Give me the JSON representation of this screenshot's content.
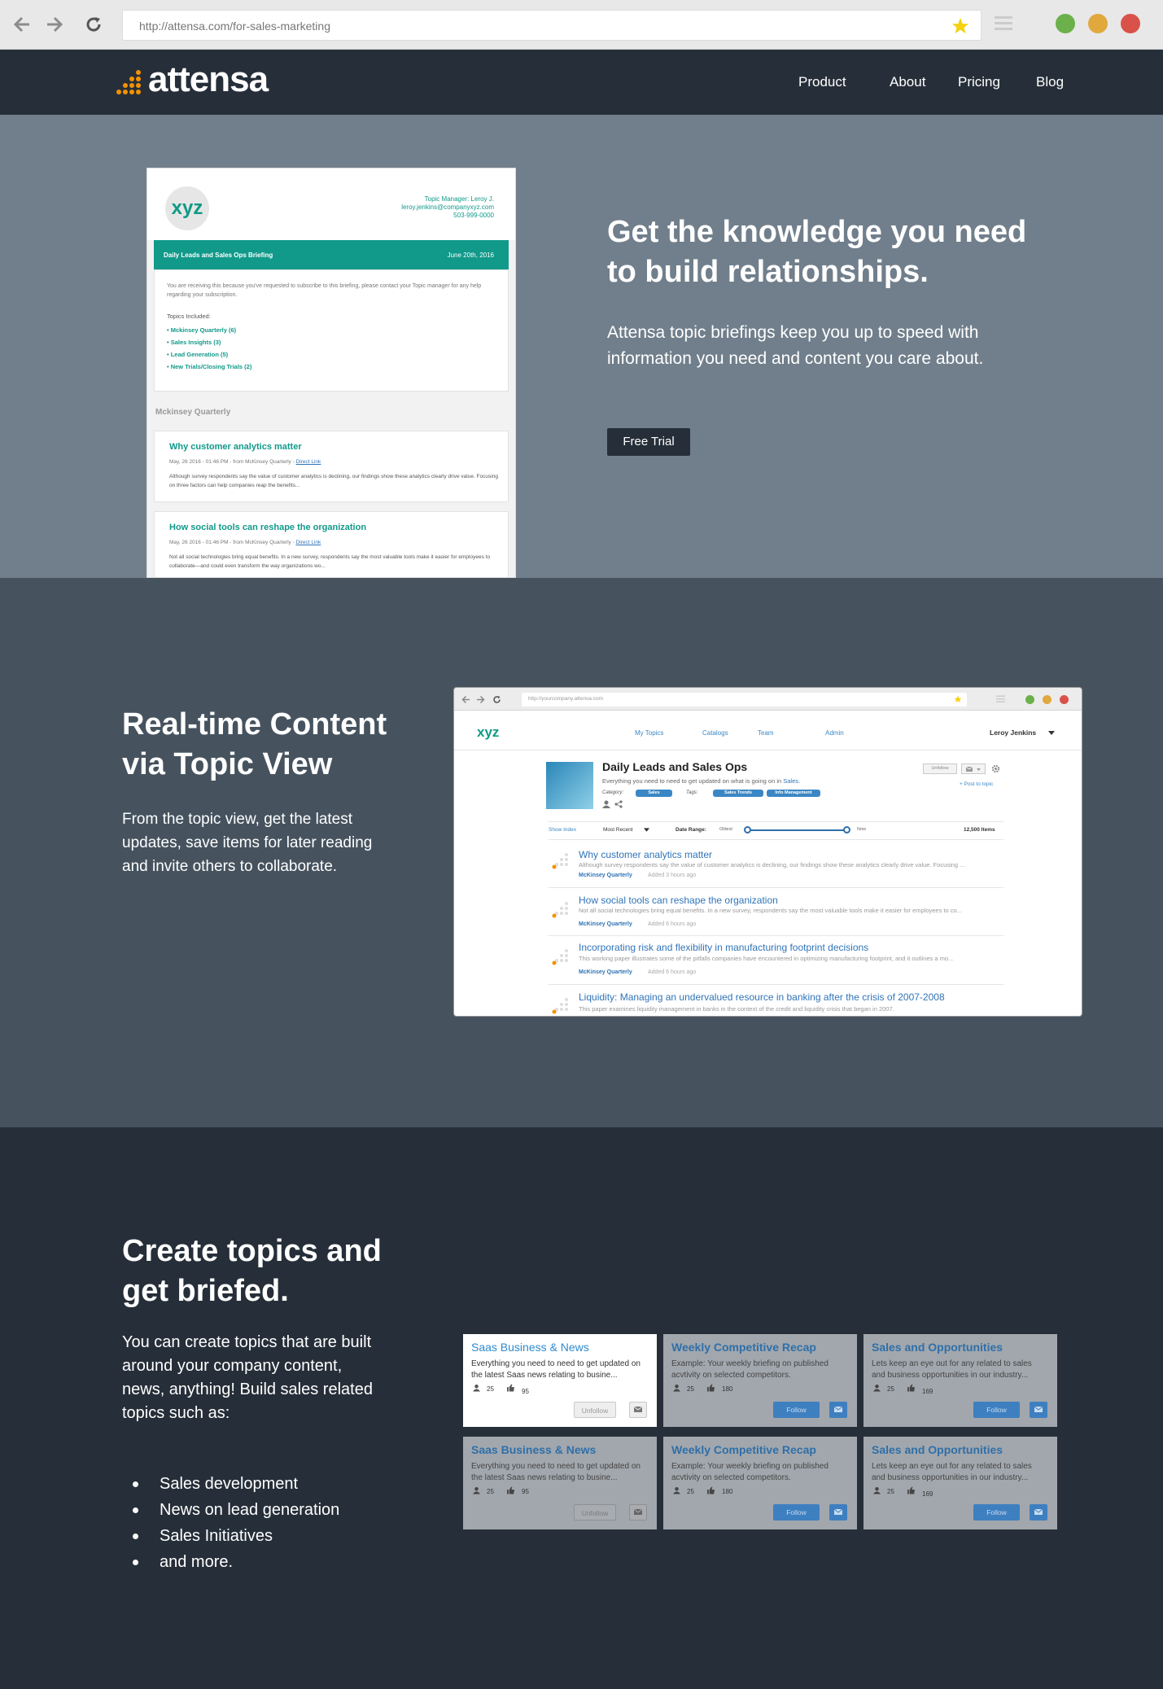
{
  "browser": {
    "url": "http://attensa.com/for-sales-marketing"
  },
  "nav": {
    "brand": "attensa",
    "links": [
      "Product",
      "About",
      "Pricing",
      "Blog"
    ]
  },
  "hero": {
    "headline": "Get the knowledge you need to build relationships.",
    "body": "Attensa topic briefings keep you up to speed with information you need and content you care about.",
    "cta": "Free Trial"
  },
  "email_mock": {
    "logo": "xyz",
    "manager_line1": "Topic Manager: Leroy J.",
    "manager_line2": "leroy.jenkins@companyxyz.com",
    "manager_line3": "503-999-0000",
    "briefing_title": "Daily  Leads and Sales Ops Briefing",
    "briefing_date": "June 20th, 2016",
    "intro": "You are receiving this because you've requested to subscribe to this briefing, please contact your Topic manager for any help regarding your subscription.",
    "topics_label": "Topics Included:",
    "topics": [
      "Mckinsey Quarterly (6)",
      "Sales Insights (3)",
      "Lead Generation (5)",
      "New Trials/Closing Trials (2)"
    ],
    "section_label": "Mckinsey Quarterly",
    "articles": [
      {
        "title": "Why customer analytics matter",
        "meta": "May, 26 2016 - 01:46 PM - from McKinsey Quarterly -",
        "link": "Direct Link",
        "body": "Although survey respondents say the value of customer analytics is declining, our findings show these analytics clearly drive value. Focusing on three factors can help companies reap the benefits..."
      },
      {
        "title": "How social tools can reshape the organization",
        "meta": "May, 26 2016 - 01:46 PM - from McKinsey Quarterly -",
        "link": "Direct Link",
        "body": "Not all social technologies bring equal benefits. In a new survey, respondents say the most valuable tools make it easier for employees to collaborate—and could even transform the way organizations wo..."
      }
    ]
  },
  "section2": {
    "headline": "Real-time Content via Topic View",
    "body": "From the topic view, get the latest updates, save items for later reading and invite others to collaborate."
  },
  "app_mock": {
    "url": "http://yourcompany.attensa.com",
    "logo": "xyz",
    "nav": [
      "My Topics",
      "Catalogs",
      "Team",
      "Admin"
    ],
    "user": "Leroy Jenkins",
    "topic_title": "Daily Leads and Sales Ops",
    "topic_desc_prefix": "Everything you need to need to get updated on what is going on in ",
    "topic_desc_link": "Sales.",
    "category_label": "Category:",
    "category": "Sales",
    "tags_label": "Tags:",
    "tags": [
      "Sales Trends",
      "Info Management"
    ],
    "unfollow": "Unfollow",
    "post_to_topic": "+ Post to topic",
    "show_index": "Show Index",
    "sort": "Most Recent",
    "date_range_label": "Date Range:",
    "oldest": "Oldest",
    "now": "Now",
    "items_count": "12,500 Items",
    "items": [
      {
        "title": "Why customer analytics matter",
        "desc": "Although survey respondents say the value of customer analytics is declining, our findings show these analytics clearly drive value. Focusing ...",
        "source": "McKinsey Quarterly",
        "added": "Added 3 hours ago"
      },
      {
        "title": "How social tools can reshape the organization",
        "desc": "Not all social technologies bring equal benefits. In a new survey, respondents say the most valuable tools make it easier for employees to co...",
        "source": "McKinsey Quarterly",
        "added": "Added 6 hours ago"
      },
      {
        "title": "Incorporating risk and flexibility in manufacturing footprint decisions",
        "desc": "This working paper illustrates some of the pitfalls companies have encountered in optimizing manufacturing footprint, and it outlines a mo...",
        "source": "McKinsey Quarterly",
        "added": "Added 6 hours ago"
      },
      {
        "title": "Liquidity: Managing an undervalued resource in banking after the crisis of 2007-2008",
        "desc": "This paper examines liquidity management in banks in the context of the credit and liquidity crisis that began in 2007.",
        "source": "",
        "added": ""
      }
    ]
  },
  "section3": {
    "headline": "Create topics and get briefed.",
    "body": "You can create topics that are built around your company content, news, anything! Build sales related topics such as:",
    "list": [
      "Sales development",
      "News on lead generation",
      "Sales Initiatives",
      "and more."
    ]
  },
  "topic_cards": [
    {
      "title": "Saas Business & News",
      "desc": "Everything you need to need to get updated on the latest Saas news relating to busine...",
      "followers": "25",
      "likes": "95",
      "action": "Unfollow",
      "active": true
    },
    {
      "title": "Weekly Competitive Recap",
      "desc": "Example: Your weekly briefing on published acvtivity on selected competitors.",
      "followers": "25",
      "likes": "180",
      "action": "Follow",
      "active": false
    },
    {
      "title": "Sales and Opportunities",
      "desc": "Lets keep an eye out for any related to sales and business opportunities in our industry...",
      "followers": "25",
      "likes": "169",
      "action": "Follow",
      "active": false
    },
    {
      "title": "Saas Business & News",
      "desc": "Everything you need to need to get updated on the latest Saas news relating to busine...",
      "followers": "25",
      "likes": "95",
      "action": "Unfollow",
      "active": false
    },
    {
      "title": "Weekly Competitive Recap",
      "desc": "Example: Your weekly briefing on published acvtivity on selected competitors.",
      "followers": "25",
      "likes": "180",
      "action": "Follow",
      "active": false
    },
    {
      "title": "Sales and Opportunities",
      "desc": "Lets keep an eye out for any related to sales and business opportunities in our industry...",
      "followers": "25",
      "likes": "169",
      "action": "Follow",
      "active": false
    }
  ],
  "colors": {
    "nav_bg": "#262f39",
    "hero_bg": "#717f8c",
    "section2_bg": "#46535f",
    "teal": "#11998a",
    "link_blue": "#3074b8",
    "brand_orange": "#f39200"
  }
}
